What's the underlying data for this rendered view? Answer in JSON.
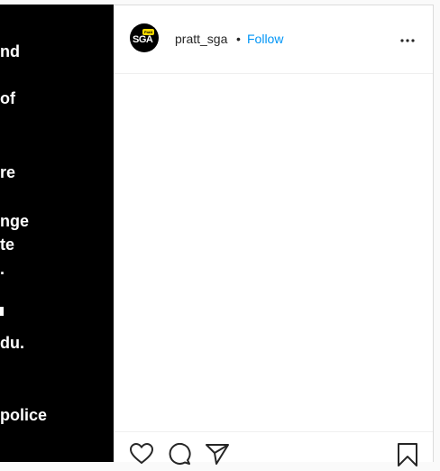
{
  "media": {
    "lines": [
      "nd",
      "of",
      "re",
      "nge",
      "te",
      ".",
      "du.",
      "police"
    ]
  },
  "post": {
    "avatar_text": "SGA",
    "avatar_tag": "Pratt",
    "username": "pratt_sga",
    "separator": "•",
    "follow_label": "Follow",
    "more_label": "•••"
  },
  "icons": {
    "like": "heart-icon",
    "comment": "comment-icon",
    "share": "paper-plane-icon",
    "save": "bookmark-icon",
    "options": "ellipsis-icon"
  },
  "colors": {
    "follow": "#0095f6",
    "media_bg": "#000000"
  }
}
